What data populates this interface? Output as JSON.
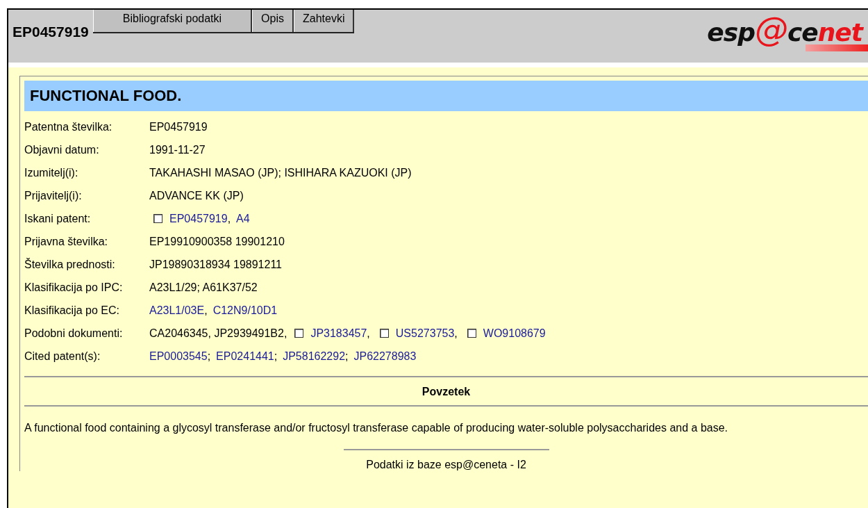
{
  "header": {
    "document_number": "EP0457919",
    "tabs": [
      {
        "label": "Bibliografski podatki",
        "selected": false
      },
      {
        "label": "Opis",
        "selected": false
      },
      {
        "label": "Zahtevki",
        "selected": false
      }
    ],
    "logo": [
      {
        "text": "esp",
        "kind": "dark"
      },
      {
        "text": "@",
        "kind": "ring"
      },
      {
        "text": "ce",
        "kind": "dark"
      },
      {
        "text": "net",
        "kind": "red"
      }
    ]
  },
  "title": "FUNCTIONAL FOOD.",
  "fields": [
    {
      "label": "Patentna številka:",
      "parts": [
        {
          "kind": "text",
          "text": "EP0457919"
        }
      ]
    },
    {
      "label": "Objavni datum:",
      "parts": [
        {
          "kind": "text",
          "text": "1991-11-27"
        }
      ]
    },
    {
      "label": "Izumitelj(i):",
      "parts": [
        {
          "kind": "text",
          "text": "TAKAHASHI MASAO (JP); ISHIHARA KAZUOKI (JP)"
        }
      ]
    },
    {
      "label": "Prijavitelj(i):",
      "parts": [
        {
          "kind": "text",
          "text": "ADVANCE KK (JP)"
        }
      ]
    },
    {
      "label": "Iskani patent:",
      "parts": [
        {
          "kind": "checkbox",
          "checked": false
        },
        {
          "kind": "link",
          "text": "EP0457919"
        },
        {
          "kind": "text",
          "text": ","
        },
        {
          "kind": "link",
          "text": "A4"
        }
      ]
    },
    {
      "label": "Prijavna številka:",
      "parts": [
        {
          "kind": "text",
          "text": "EP19910900358 19901210"
        }
      ]
    },
    {
      "label": "Številka prednosti:",
      "parts": [
        {
          "kind": "text",
          "text": "JP19890318934 19891211"
        }
      ]
    },
    {
      "label": "Klasifikacija po IPC:",
      "parts": [
        {
          "kind": "text",
          "text": "A23L1/29; A61K37/52"
        }
      ]
    },
    {
      "label": "Klasifikacija po EC:",
      "parts": [
        {
          "kind": "link",
          "text": "A23L1/03E"
        },
        {
          "kind": "text",
          "text": ","
        },
        {
          "kind": "link",
          "text": "C12N9/10D1"
        }
      ]
    },
    {
      "label": "Podobni dokumenti:",
      "parts": [
        {
          "kind": "text",
          "text": "CA2046345, JP2939491B2,"
        },
        {
          "kind": "checkbox",
          "checked": false
        },
        {
          "kind": "link",
          "text": "JP3183457"
        },
        {
          "kind": "text",
          "text": ","
        },
        {
          "kind": "checkbox",
          "checked": false
        },
        {
          "kind": "link",
          "text": "US5273753"
        },
        {
          "kind": "text",
          "text": ","
        },
        {
          "kind": "checkbox",
          "checked": false
        },
        {
          "kind": "link",
          "text": "WO9108679"
        }
      ]
    },
    {
      "label": "Cited patent(s):",
      "parts": [
        {
          "kind": "link",
          "text": "EP0003545"
        },
        {
          "kind": "text",
          "text": ";"
        },
        {
          "kind": "link",
          "text": "EP0241441"
        },
        {
          "kind": "text",
          "text": ";"
        },
        {
          "kind": "link",
          "text": "JP58162292"
        },
        {
          "kind": "text",
          "text": ";"
        },
        {
          "kind": "link",
          "text": "JP62278983"
        }
      ]
    }
  ],
  "abstract": {
    "heading": "Povzetek",
    "text": "A functional food containing a glycosyl transferase and/or fructosyl transferase capable of producing water-soluble polysaccharides and a base."
  },
  "footer": "Podatki iz baze esp@ceneta - I2"
}
